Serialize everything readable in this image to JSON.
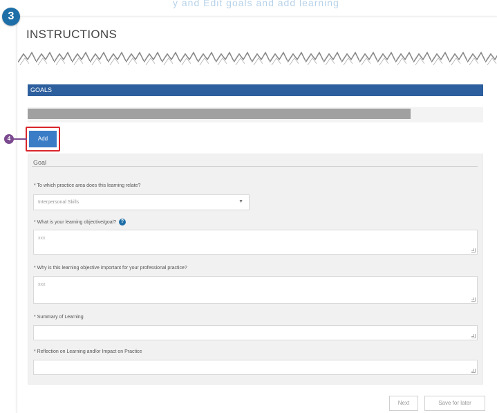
{
  "badges": {
    "instructions_step": "3",
    "add_step": "4"
  },
  "top_strip_text": "y and Edit goals and add learning",
  "instructions": {
    "title": "INSTRUCTIONS"
  },
  "goals_section": {
    "title": "GOALS",
    "progress_fraction": 0.84,
    "add_label": "Add"
  },
  "goal_form": {
    "heading": "Goal",
    "practice_area": {
      "label": "* To which practice area does this learning relate?",
      "selected": "Interpersonal Skills"
    },
    "objective": {
      "label": "* What is your learning objective/goal?",
      "value": "xxx"
    },
    "importance": {
      "label": "* Why is this learning objective important for your professional practice?",
      "value": "xxx"
    },
    "summary": {
      "label": "* Summary of Learning",
      "value": ""
    },
    "reflection": {
      "label": "* Reflection on Learning and/or Impact on Practice",
      "value": ""
    }
  },
  "footer": {
    "next_label": "Next",
    "save_label": "Save for later"
  },
  "colors": {
    "section_bar": "#2d5f9e",
    "add_button": "#3a7cc6",
    "highlight": "#d9262c",
    "badge_primary": "#1e6fa8",
    "badge_secondary": "#7b4a8f"
  },
  "icons": [
    "help-icon",
    "chevron-down-icon",
    "resize-handle-icon"
  ]
}
